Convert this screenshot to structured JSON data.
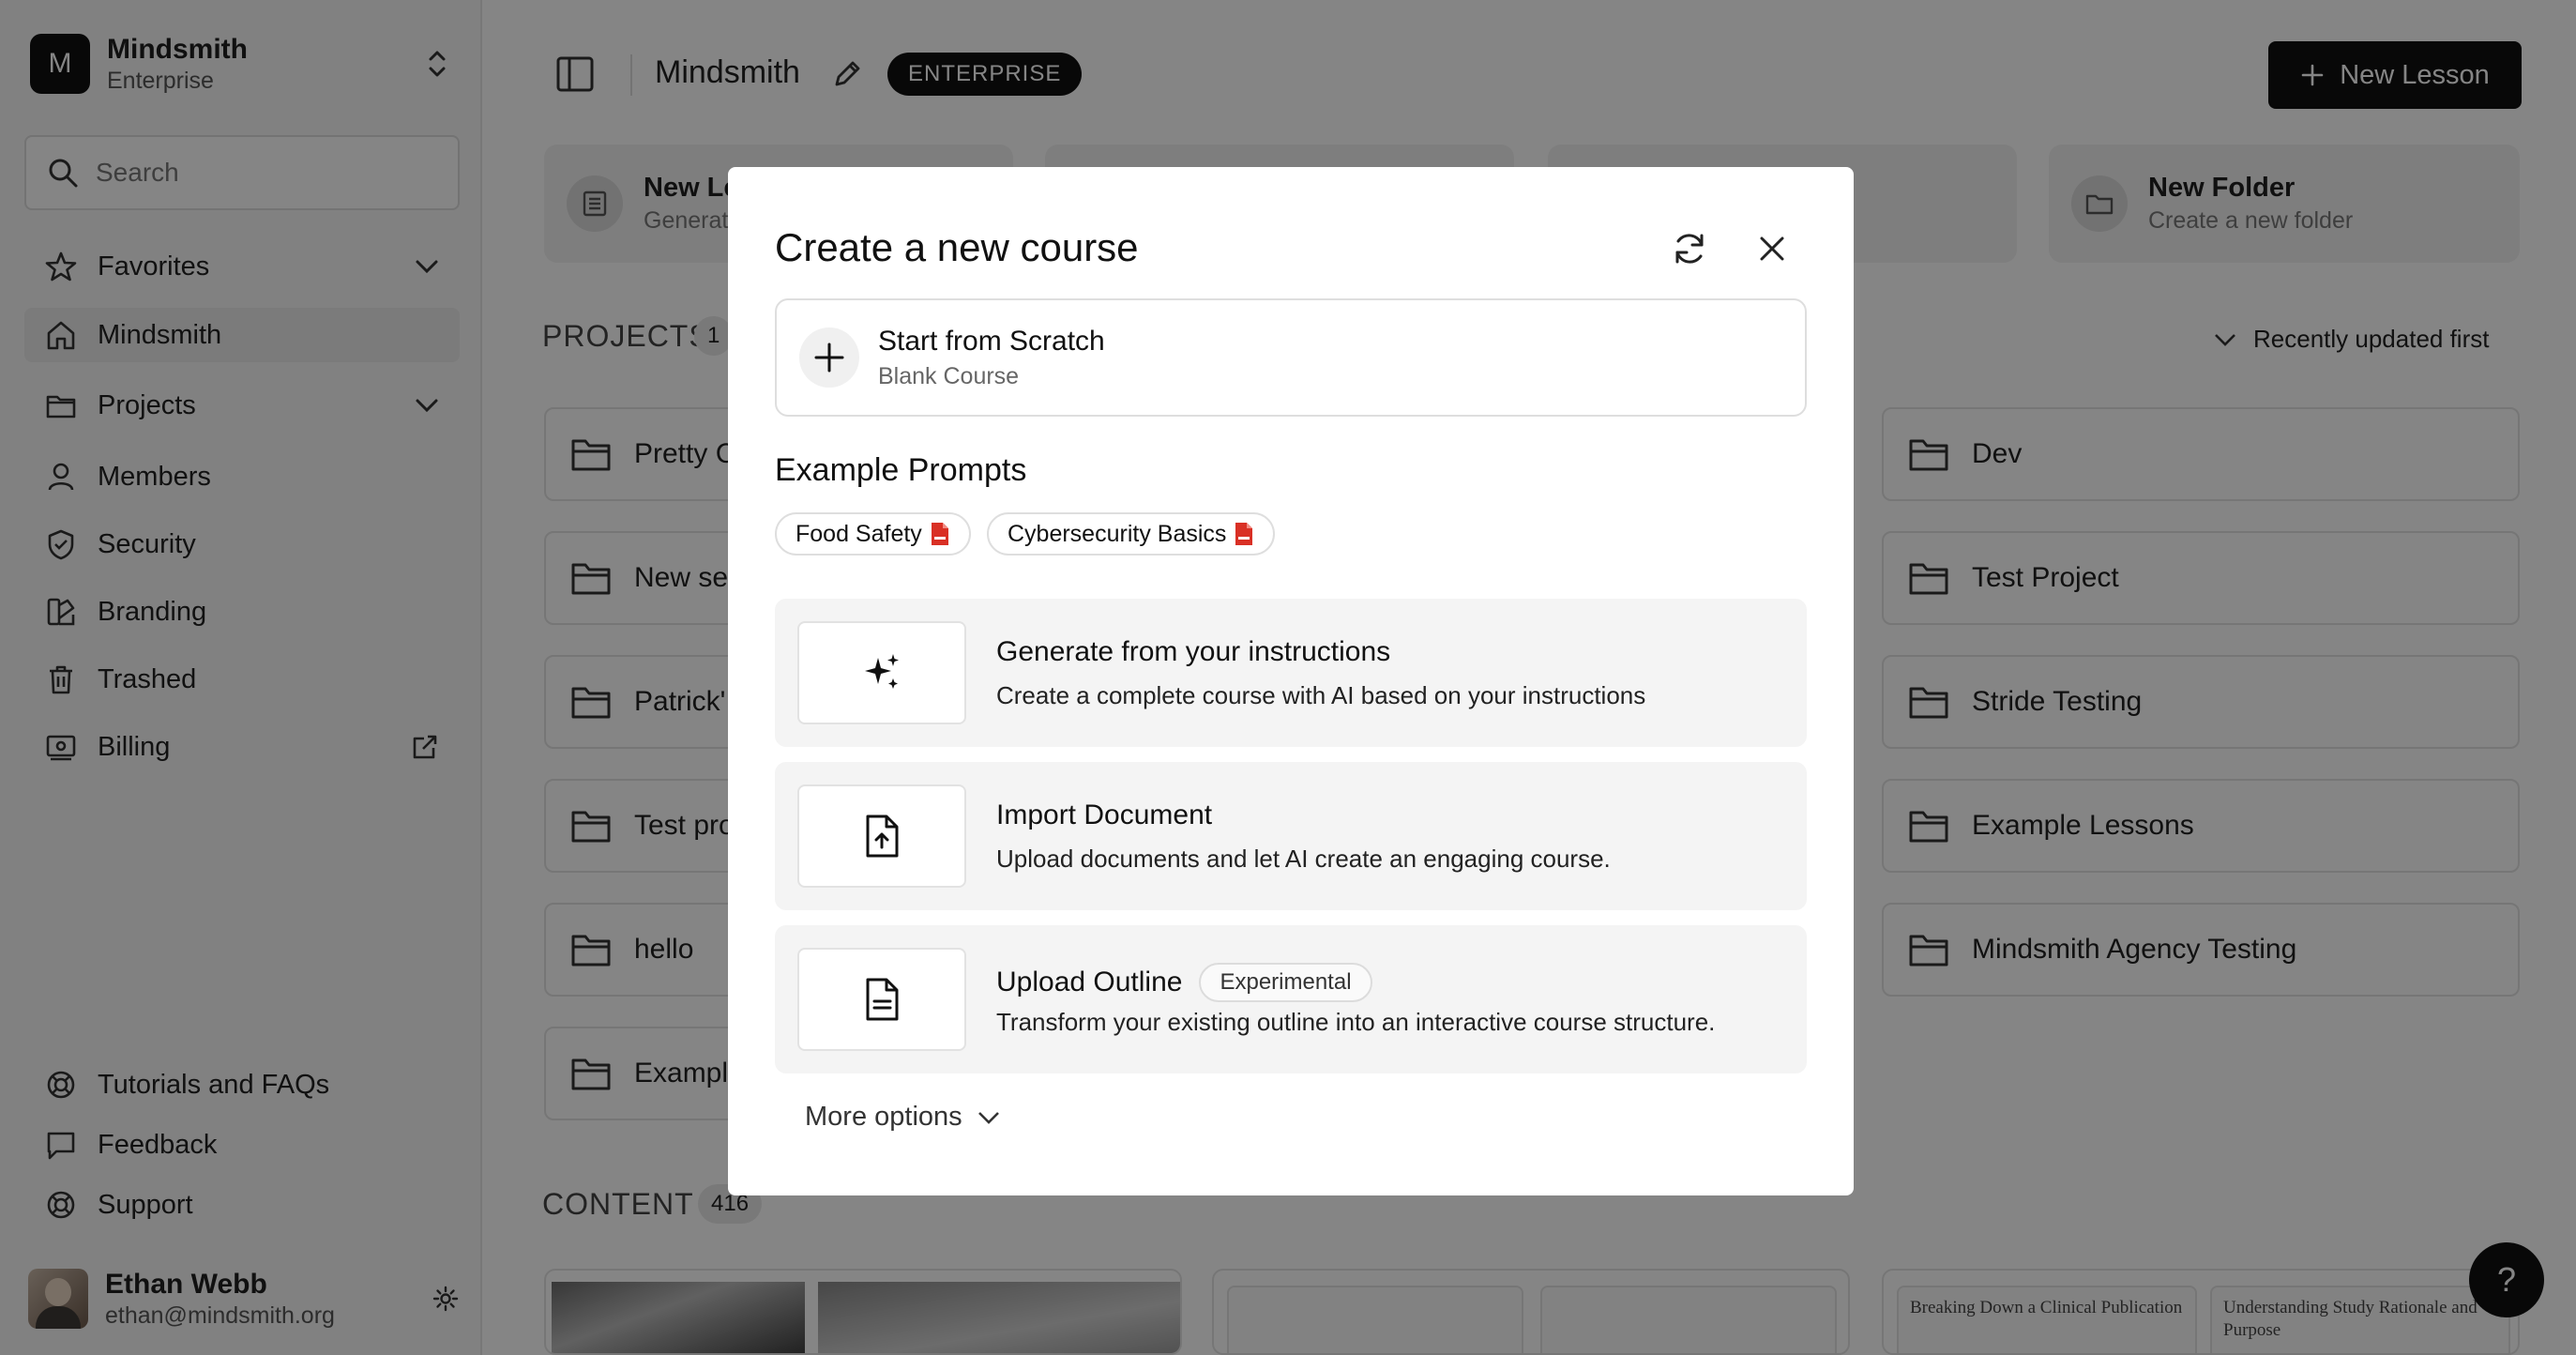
{
  "sidebar": {
    "org": {
      "initial": "M",
      "name": "Mindsmith",
      "plan": "Enterprise"
    },
    "search_placeholder": "Search",
    "nav": [
      {
        "label": "Favorites"
      },
      {
        "label": "Mindsmith"
      },
      {
        "label": "Projects"
      },
      {
        "label": "Members"
      },
      {
        "label": "Security"
      },
      {
        "label": "Branding"
      },
      {
        "label": "Trashed"
      },
      {
        "label": "Billing"
      }
    ],
    "bottom": [
      {
        "label": "Tutorials and FAQs"
      },
      {
        "label": "Feedback"
      },
      {
        "label": "Support"
      }
    ],
    "user": {
      "name": "Ethan Webb",
      "email": "ethan@mindsmith.org"
    }
  },
  "header": {
    "title": "Mindsmith",
    "badge": "ENTERPRISE",
    "new_lesson_label": "New Lesson"
  },
  "quick_actions": [
    {
      "title": "New Le",
      "subtitle": "Generat"
    },
    {
      "title": "New Folder",
      "subtitle": "Create a new folder"
    }
  ],
  "projects": {
    "label": "PROJECTS",
    "count": "1",
    "sort_label": "Recently updated first",
    "left_folders": [
      "Pretty C",
      "New se",
      "Patrick'",
      "Test pro",
      "hello",
      "Exampl"
    ],
    "right_folders": [
      "Dev",
      "Test Project",
      "Stride Testing",
      "Example Lessons",
      "Mindsmith Agency Testing"
    ]
  },
  "content": {
    "label": "CONTENT",
    "count": "416",
    "cards": [
      "Breaking Down a Clinical Publication",
      "Understanding Study Rationale and Purpose"
    ]
  },
  "help_label": "?",
  "modal": {
    "title": "Create a new course",
    "scratch": {
      "title": "Start from Scratch",
      "subtitle": "Blank Course"
    },
    "examples_heading": "Example Prompts",
    "chips": [
      "Food Safety",
      "Cybersecurity Basics"
    ],
    "options": [
      {
        "title": "Generate from your instructions",
        "desc": "Create a complete course with AI based on your instructions",
        "icon": "sparkles-icon"
      },
      {
        "title": "Import Document",
        "desc": "Upload documents and let AI create an engaging course.",
        "icon": "file-upload-icon"
      },
      {
        "title": "Upload Outline",
        "desc": "Transform your existing outline into an interactive course structure.",
        "badge": "Experimental",
        "icon": "file-text-icon"
      }
    ],
    "more_options": "More options"
  },
  "colors": {
    "accent": "#111111",
    "pdf_red": "#d93025",
    "overlay": "rgba(0,0,0,0.48)"
  }
}
